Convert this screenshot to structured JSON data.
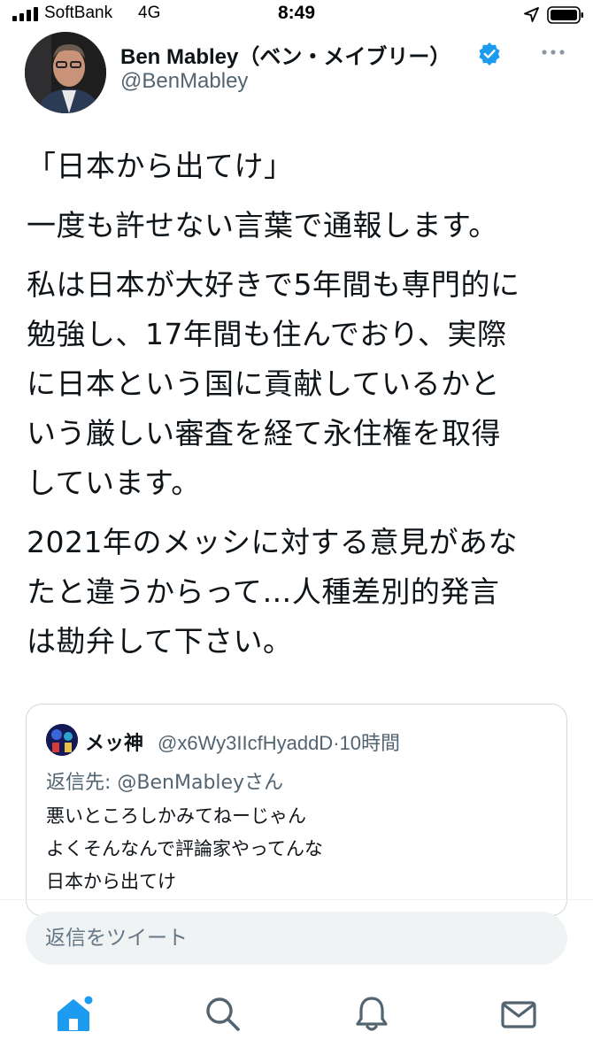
{
  "status_bar": {
    "carrier": "SoftBank",
    "network": "4G",
    "time": "8:49"
  },
  "tweet": {
    "author_name": "Ben Mabley（ベン・メイブリー）",
    "author_handle": "@BenMabley",
    "paragraphs": [
      "「日本から出てけ」",
      "一度も許せない言葉で通報します。",
      "私は日本が大好きで5年間も専門的に",
      "勉強し、17年間も住んでおり、実際",
      "に日本という国に貢献しているかと",
      "いう厳しい審査を経て永住権を取得",
      "しています。",
      "2021年のメッシに対する意見があな",
      "たと違うからって…人種差別的発言",
      "は勘弁して下さい。"
    ]
  },
  "quote": {
    "author_name": "メッ神",
    "author_handle_time": "@x6Wy3IIcfHyaddD·10時間",
    "reply_to": "返信先: @BenMableyさん",
    "lines": [
      "悪いところしかみてねーじゃん",
      "よくそんなんで評論家やってんな",
      "日本から出てけ"
    ]
  },
  "reply_box": {
    "placeholder": "返信をツイート"
  },
  "colors": {
    "accent": "#1d9bf0",
    "secondary_text": "#536471",
    "border": "#cfd9de",
    "input_bg": "#eff3f4"
  },
  "icons": {
    "nav": [
      "home-icon",
      "search-icon",
      "notifications-icon",
      "messages-icon"
    ]
  }
}
